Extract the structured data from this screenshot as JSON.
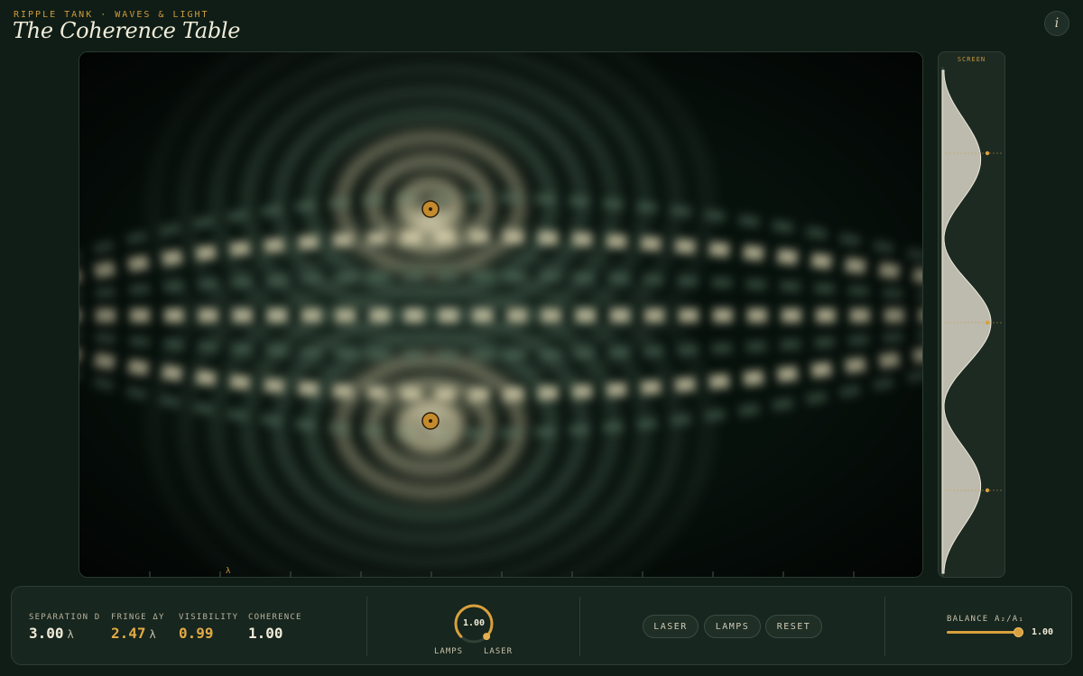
{
  "header": {
    "eyebrow": "RIPPLE TANK · WAVES & LIGHT",
    "title": "The Coherence Table",
    "info_label": "i"
  },
  "tank": {
    "wavelength_label": "λ",
    "sources": [
      "source-top",
      "source-bottom"
    ]
  },
  "screen": {
    "label": "SCREEN"
  },
  "readouts": [
    {
      "label": "SEPARATION D",
      "value": "3.00",
      "unit": "λ"
    },
    {
      "label": "FRINGE ΔY",
      "value": "2.47",
      "unit": "λ"
    },
    {
      "label": "VISIBILITY",
      "value": "0.99",
      "unit": ""
    },
    {
      "label": "COHERENCE",
      "value": "1.00",
      "unit": ""
    }
  ],
  "coherence_dial": {
    "value_text": "1.00",
    "value": 1.0,
    "left_label": "LAMPS",
    "right_label": "LASER"
  },
  "modes": {
    "laser": "LASER",
    "lamps": "LAMPS",
    "reset": "RESET"
  },
  "balance": {
    "label": "BALANCE A₂/A₁",
    "value_text": "1.00",
    "fraction": 0.95
  },
  "colors": {
    "accent": "#d9a03d",
    "background": "#0f1d16",
    "wave_light": "#f1ead0",
    "wave_mid": "#5d7d68"
  }
}
